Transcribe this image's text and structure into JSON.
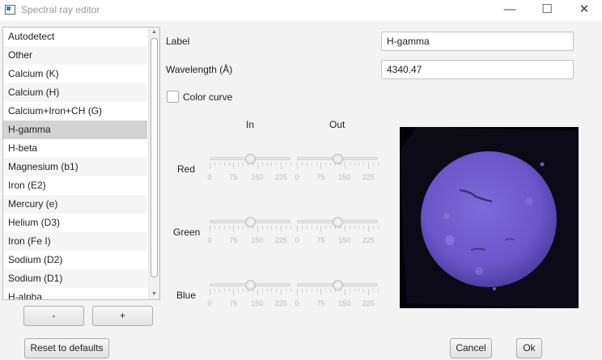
{
  "window": {
    "title": "Spectral ray editor",
    "minimize_glyph": "—",
    "maximize_glyph": "☐",
    "close_glyph": "✕"
  },
  "ray_list": {
    "selected_index": 5,
    "items": [
      "Autodetect",
      "Other",
      "Calcium (K)",
      "Calcium (H)",
      "Calcium+Iron+CH (G)",
      "H-gamma",
      "H-beta",
      "Magnesium (b1)",
      "Iron (E2)",
      "Mercury (e)",
      "Helium (D3)",
      "Iron (Fe I)",
      "Sodium (D2)",
      "Sodium (D1)",
      "H-alpha"
    ]
  },
  "list_buttons": {
    "remove_label": "-",
    "add_label": "+"
  },
  "form": {
    "label_caption": "Label",
    "label_value": "H-gamma",
    "wavelength_caption": "Wavelength (Å)",
    "wavelength_value": "4340.47",
    "color_curve_label": "Color curve",
    "color_curve_checked": false
  },
  "curves": {
    "in_header": "In",
    "out_header": "Out",
    "tick_labels": [
      "0",
      "75",
      "150",
      "225"
    ],
    "slider_max": 255,
    "channels": [
      {
        "name": "Red",
        "in_value": 127,
        "out_value": 127
      },
      {
        "name": "Green",
        "in_value": 127,
        "out_value": 127
      },
      {
        "name": "Blue",
        "in_value": 127,
        "out_value": 127
      }
    ]
  },
  "preview": {
    "sun_color": "#6a56c9",
    "background_color": "#040308"
  },
  "footer": {
    "reset_label": "Reset to defaults",
    "cancel_label": "Cancel",
    "ok_label": "Ok"
  }
}
